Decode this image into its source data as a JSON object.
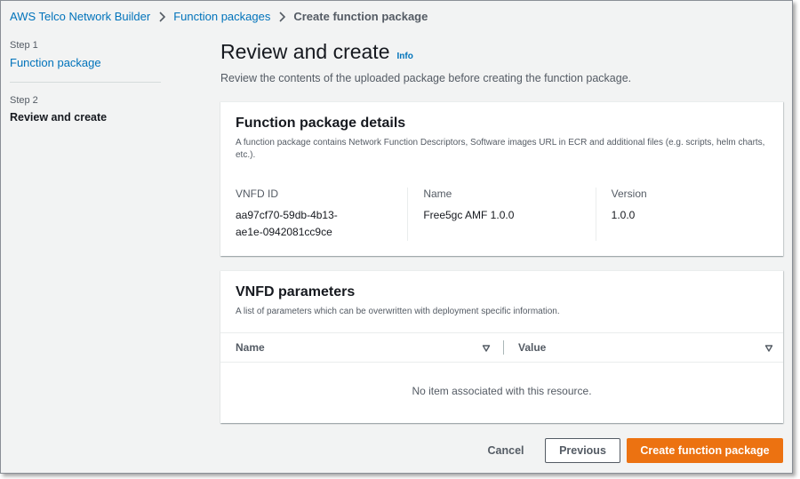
{
  "breadcrumb": {
    "items": [
      "AWS Telco Network Builder",
      "Function packages"
    ],
    "current": "Create function package"
  },
  "steps": [
    {
      "number": "Step 1",
      "label": "Function package"
    },
    {
      "number": "Step 2",
      "label": "Review and create"
    }
  ],
  "page": {
    "title": "Review and create",
    "info": "Info",
    "description": "Review the contents of the uploaded package before creating the function package."
  },
  "details_panel": {
    "title": "Function package details",
    "description": "A function package contains Network Function Descriptors, Software images URL in ECR and additional files (e.g. scripts, helm charts, etc.).",
    "fields": [
      {
        "label": "VNFD ID",
        "value_line1": "aa97cf70-59db-4b13-",
        "value_line2": "ae1e-0942081cc9ce"
      },
      {
        "label": "Name",
        "value": "Free5gc AMF 1.0.0"
      },
      {
        "label": "Version",
        "value": "1.0.0"
      }
    ]
  },
  "params_panel": {
    "title": "VNFD parameters",
    "description": "A list of parameters which can be overwritten with deployment specific information.",
    "columns": [
      "Name",
      "Value"
    ],
    "empty_message": "No item associated with this resource."
  },
  "actions": {
    "cancel": "Cancel",
    "previous": "Previous",
    "primary": "Create function package"
  },
  "colors": {
    "link": "#0073bb",
    "primary_button": "#ec7211",
    "background": "#f2f3f3"
  },
  "icons": [
    "chevron-right-icon",
    "sort-triangle-icon"
  ]
}
